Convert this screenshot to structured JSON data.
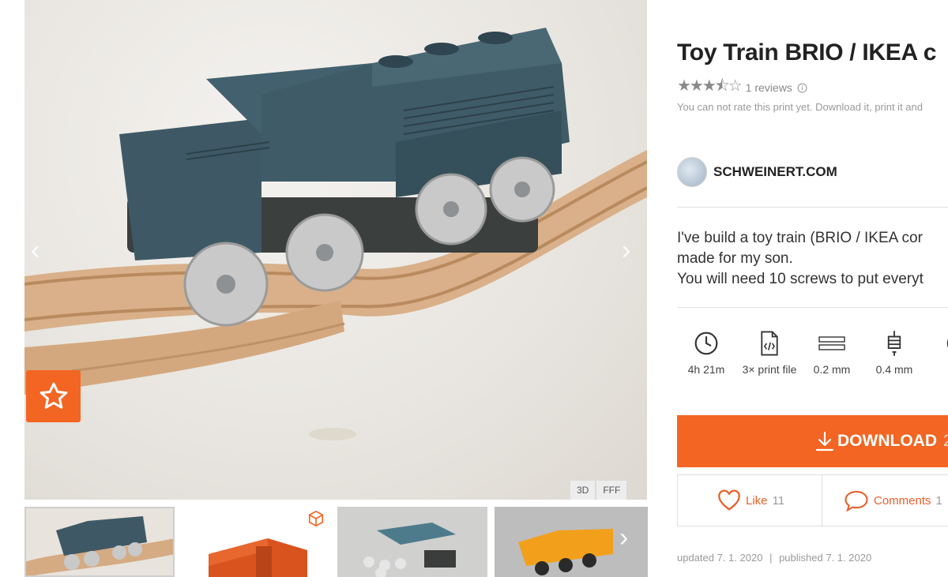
{
  "title": "Toy Train BRIO / IKEA c",
  "rating": {
    "stars": 3.5,
    "reviews_label": "1 reviews",
    "note": "You can not rate this print yet. Download it, print it and"
  },
  "author": {
    "name": "SCHWEINERT.COM"
  },
  "description": [
    "I've build a toy train (BRIO / IKEA cor",
    "made for my son.",
    "You will need 10 screws to put everyt"
  ],
  "params": [
    {
      "icon": "clock-icon",
      "label": "4h 21m"
    },
    {
      "icon": "file-code-icon",
      "label": "3× print file"
    },
    {
      "icon": "layer-height-icon",
      "label": "0.2 mm"
    },
    {
      "icon": "nozzle-icon",
      "label": "0.4 mm"
    }
  ],
  "download": {
    "label": "DOWNLOAD",
    "suffix": "2"
  },
  "like": {
    "label": "Like",
    "count": "11"
  },
  "comments": {
    "label": "Comments",
    "count": "1"
  },
  "dates": {
    "updated": "updated 7. 1. 2020",
    "sep": "|",
    "published": "published 7. 1. 2020"
  },
  "gallery": {
    "tags": [
      "3D",
      "FFF"
    ]
  },
  "colors": {
    "accent": "#f26522",
    "train_blue": "#3d5763",
    "wood": "#d7ae86"
  }
}
